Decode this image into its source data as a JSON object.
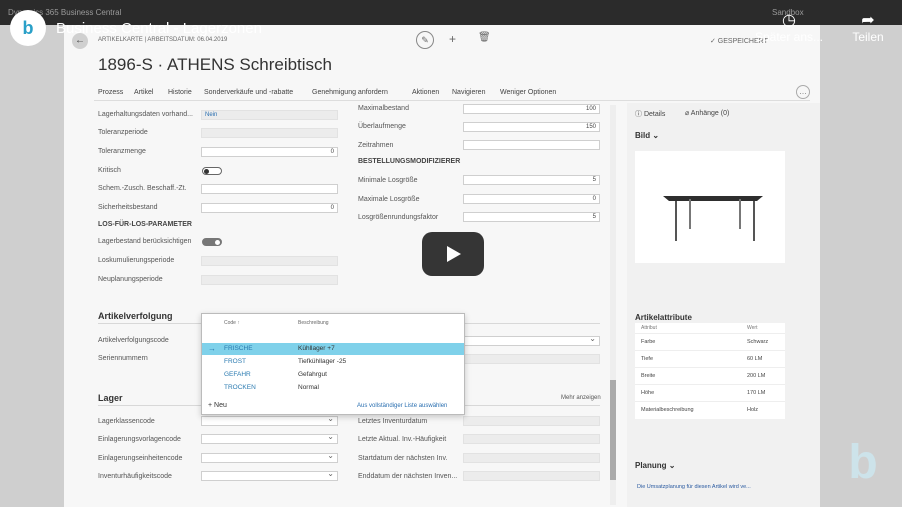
{
  "top": {
    "app": "Dynamics 365 Business Central",
    "sandbox": "Sandbox"
  },
  "video": {
    "title": "Business Central - Lagerzonen",
    "later": "Später ans...",
    "share": "Teilen",
    "channel_logo": "b"
  },
  "header": {
    "breadcrumb": "ARTIKELKARTE | ARBEITSDATUM: 06.04.2019",
    "saved": "✓ GESPEICHERT",
    "title": "1896-S · ATHENS Schreibtisch"
  },
  "menu": [
    "Prozess",
    "Artikel",
    "Historie",
    "Sonderverkäufe und -rabatte",
    "Genehmigung anfordern",
    "Aktionen",
    "Navigieren",
    "Weniger Optionen"
  ],
  "left_col": {
    "lagerhaltungsdaten_label": "Lagerhaltungsdaten vorhand...",
    "lagerhaltungsdaten_value": "Nein",
    "toleranzperiode": "Toleranzperiode",
    "toleranzmenge": "Toleranzmenge",
    "toleranzmenge_value": "0",
    "kritisch": "Kritisch",
    "schem": "Schem.-Zusch. Beschaff.-Zt.",
    "sicherheitsbestand": "Sicherheitsbestand",
    "sicherheitsbestand_value": "0",
    "los_header": "LOS-FÜR-LOS-PARAMETER",
    "lagerbestand": "Lagerbestand berücksichtigen",
    "loskumulierung": "Loskumulierungsperiode",
    "neuplanung": "Neuplanungsperiode"
  },
  "right_col": {
    "maximalbestand": "Maximalbestand",
    "maximalbestand_value": "100",
    "ueberlauf": "Überlaufmenge",
    "ueberlauf_value": "150",
    "zeitrahmen": "Zeitrahmen",
    "bestellmod": "BESTELLUNGSMODIFIZIERER",
    "minimale": "Minimale Losgröße",
    "minimale_value": "5",
    "maximale": "Maximale Losgröße",
    "maximale_value": "0",
    "rundung": "Losgrößenrundungsfaktor",
    "rundung_value": "5"
  },
  "artikelverfolgung": {
    "title": "Artikelverfolgung",
    "code": "Artikelverfolgungscode",
    "serien": "Seriennummern"
  },
  "popup": {
    "col_code": "Code ↑",
    "col_desc": "Beschreibung",
    "rows": [
      {
        "code": "FRISCHE",
        "desc": "Kühllager +7"
      },
      {
        "code": "FROST",
        "desc": "Tiefkühllager -25"
      },
      {
        "code": "GEFAHR",
        "desc": "Gefahrgut"
      },
      {
        "code": "TROCKEN",
        "desc": "Normal"
      }
    ],
    "new": "+ Neu",
    "full": "Aus vollständiger Liste auswählen"
  },
  "lager": {
    "title": "Lager",
    "more": "Mehr anzeigen",
    "klasse": "Lagerklassencode",
    "einlag_vorlage": "Einlagerungsvorlagencode",
    "einlag_einheit": "Einlagerungseinheitencode",
    "inventur": "Inventurhäufigkeitscode",
    "letztes": "Letztes Inventurdatum",
    "letzte_aktual": "Letzte Aktual. Inv.-Häufigkeit",
    "start": "Startdatum der nächsten Inv.",
    "end": "Enddatum der nächsten Inven..."
  },
  "factbox": {
    "details": "Details",
    "anhaenge": "Anhänge (0)",
    "bild": "Bild",
    "attr_title": "Artikelattribute",
    "attr_col1": "Attribut",
    "attr_col2": "Wert",
    "attrs": [
      {
        "k": "Farbe",
        "v": "Schwarz"
      },
      {
        "k": "Tiefe",
        "v": "60 LM"
      },
      {
        "k": "Breite",
        "v": "200 LM"
      },
      {
        "k": "Höhe",
        "v": "170 LM"
      },
      {
        "k": "Materialbeschreibung",
        "v": "Holz"
      }
    ],
    "planung": "Planung",
    "planung_text": "Die Umsatzplanung für diesen Artikel wird ve..."
  },
  "colors": {
    "accent": "#7fd1ea",
    "link": "#2a6fb0"
  }
}
